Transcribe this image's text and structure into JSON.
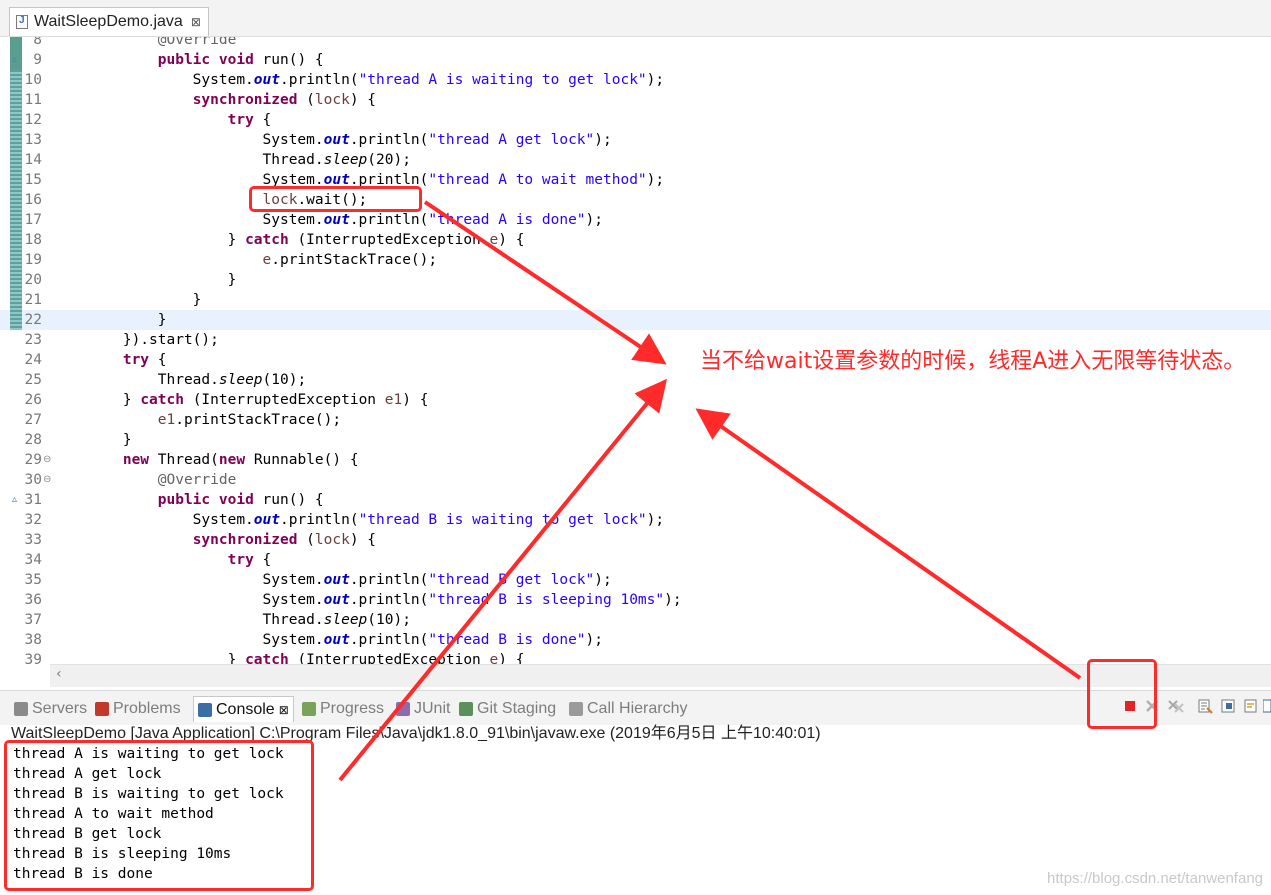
{
  "editor": {
    "tab": {
      "title": "WaitSleepDemo.java",
      "close": "⊠"
    },
    "lines": [
      {
        "n": "8",
        "fold": "",
        "marker": "solid",
        "html": "            <span class='ann'>@Override</span>"
      },
      {
        "n": "9",
        "fold": "",
        "marker": "solid",
        "warn": "▵",
        "html": "            <span class='kw'>public</span> <span class='kw'>void</span> run() {"
      },
      {
        "n": "10",
        "fold": "",
        "marker": "dotted",
        "html": "                System.<span class='field'>out</span>.println(<span class='str'>\"thread A is waiting to get lock\"</span>);"
      },
      {
        "n": "11",
        "fold": "",
        "marker": "dotted",
        "html": "                <span class='kw'>synchronized</span> (<span class='lvar'>lock</span>) {"
      },
      {
        "n": "12",
        "fold": "",
        "marker": "dotted",
        "html": "                    <span class='kw'>try</span> {"
      },
      {
        "n": "13",
        "fold": "",
        "marker": "dotted",
        "html": "                        System.<span class='field'>out</span>.println(<span class='str'>\"thread A get lock\"</span>);"
      },
      {
        "n": "14",
        "fold": "",
        "marker": "dotted",
        "html": "                        Thread.<span class='sm'>sleep</span>(20);"
      },
      {
        "n": "15",
        "fold": "",
        "marker": "dotted",
        "html": "                        System.<span class='field'>out</span>.println(<span class='str'>\"thread A to wait method\"</span>);"
      },
      {
        "n": "16",
        "fold": "",
        "marker": "dotted",
        "html": "                        <span class='lvar'>lock</span>.wait();"
      },
      {
        "n": "17",
        "fold": "",
        "marker": "dotted",
        "html": "                        System.<span class='field'>out</span>.println(<span class='str'>\"thread A is done\"</span>);"
      },
      {
        "n": "18",
        "fold": "",
        "marker": "dotted",
        "html": "                    } <span class='kw'>catch</span> (InterruptedException <span class='lvar'>e</span>) {"
      },
      {
        "n": "19",
        "fold": "",
        "marker": "dotted",
        "html": "                        <span class='lvar'>e</span>.printStackTrace();"
      },
      {
        "n": "20",
        "fold": "",
        "marker": "dotted",
        "html": "                    }"
      },
      {
        "n": "21",
        "fold": "",
        "marker": "dotted",
        "html": "                }"
      },
      {
        "n": "22",
        "fold": "",
        "marker": "dotted",
        "current": true,
        "html": "            }"
      },
      {
        "n": "23",
        "fold": "",
        "html": "        }).start();"
      },
      {
        "n": "24",
        "fold": "",
        "html": "        <span class='kw'>try</span> {"
      },
      {
        "n": "25",
        "fold": "",
        "html": "            Thread.<span class='sm'>sleep</span>(10);"
      },
      {
        "n": "26",
        "fold": "",
        "html": "        } <span class='kw'>catch</span> (InterruptedException <span class='lvar'>e1</span>) {"
      },
      {
        "n": "27",
        "fold": "",
        "html": "            <span class='lvar'>e1</span>.printStackTrace();"
      },
      {
        "n": "28",
        "fold": "",
        "html": "        }"
      },
      {
        "n": "29",
        "fold": "⊖",
        "html": "        <span class='kw'>new</span> Thread(<span class='kw'>new</span> Runnable() {"
      },
      {
        "n": "30",
        "fold": "⊖",
        "html": "            <span class='ann'>@Override</span>"
      },
      {
        "n": "31",
        "fold": "",
        "warn": "▵",
        "html": "            <span class='kw'>public</span> <span class='kw'>void</span> run() {"
      },
      {
        "n": "32",
        "fold": "",
        "html": "                System.<span class='field'>out</span>.println(<span class='str'>\"thread B is waiting to get lock\"</span>);"
      },
      {
        "n": "33",
        "fold": "",
        "html": "                <span class='kw'>synchronized</span> (<span class='lvar'>lock</span>) {"
      },
      {
        "n": "34",
        "fold": "",
        "html": "                    <span class='kw'>try</span> {"
      },
      {
        "n": "35",
        "fold": "",
        "html": "                        System.<span class='field'>out</span>.println(<span class='str'>\"thread B get lock\"</span>);"
      },
      {
        "n": "36",
        "fold": "",
        "html": "                        System.<span class='field'>out</span>.println(<span class='str'>\"thread B is sleeping 10ms\"</span>);"
      },
      {
        "n": "37",
        "fold": "",
        "html": "                        Thread.<span class='sm'>sleep</span>(10);"
      },
      {
        "n": "38",
        "fold": "",
        "html": "                        System.<span class='field'>out</span>.println(<span class='str'>\"thread B is done\"</span>);"
      },
      {
        "n": "39",
        "fold": "",
        "html": "                    } <span class='kw'>catch</span> (InterruptedException <span class='lvar'>e</span>) {"
      }
    ]
  },
  "panel": {
    "tabs": [
      {
        "label": "Servers",
        "icon": "servers-icon",
        "color": "#8a8a8a"
      },
      {
        "label": "Problems",
        "icon": "problems-icon",
        "color": "#c0392b"
      },
      {
        "label": "Console",
        "icon": "console-icon",
        "color": "#3a6ea5",
        "active": true,
        "close": "⊠"
      },
      {
        "label": "Progress",
        "icon": "progress-icon",
        "color": "#7aa35a"
      },
      {
        "label": "JUnit",
        "icon": "junit-icon",
        "color": "#8c6bb1"
      },
      {
        "label": "Git Staging",
        "icon": "git-staging-icon",
        "color": "#5b8f5b"
      },
      {
        "label": "Call Hierarchy",
        "icon": "call-hierarchy-icon",
        "color": "#9a9a9a"
      }
    ],
    "console_header": "WaitSleepDemo [Java Application] C:\\Program Files\\Java\\jdk1.8.0_91\\bin\\javaw.exe (2019年6月5日 上午10:40:01)",
    "console_lines": [
      "thread A is waiting to get lock",
      "thread A get lock",
      "thread B is waiting to get lock",
      "thread A to wait method",
      "thread B get lock",
      "thread B is sleeping 10ms",
      "thread B is done"
    ]
  },
  "annotation": {
    "text": "当不给wait设置参数的时候，线程A进入无限等待状态。",
    "color": "#ff2a2a"
  },
  "watermark": "https://blog.csdn.net/tanwenfang"
}
